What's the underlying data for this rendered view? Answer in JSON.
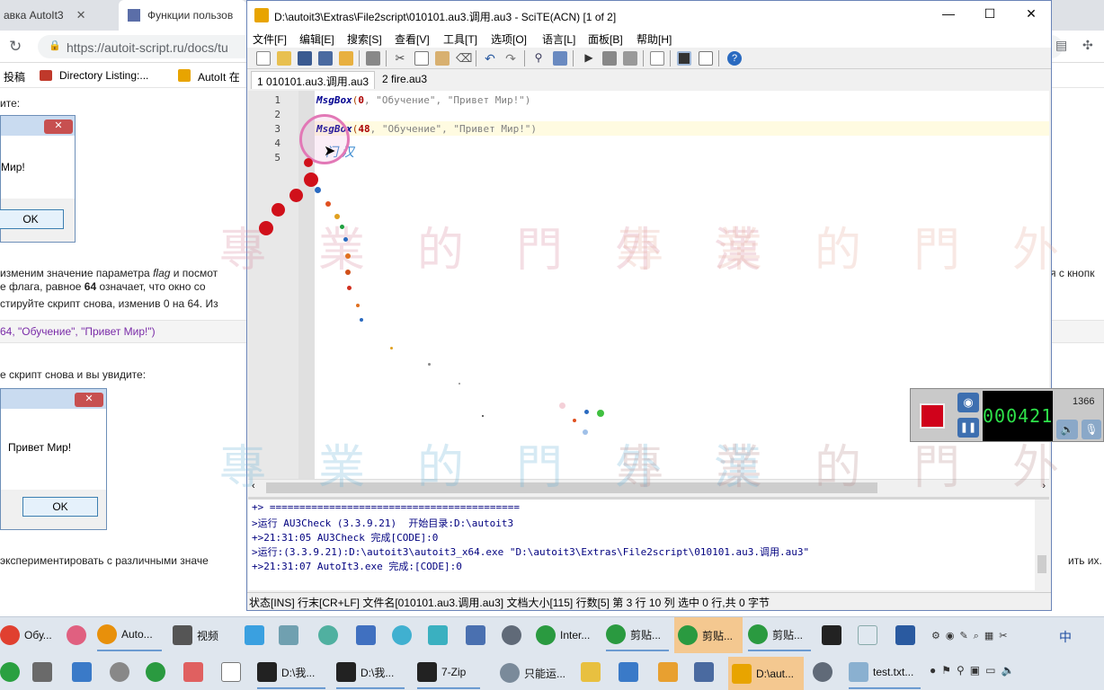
{
  "browser": {
    "tabs": [
      {
        "title": "авка AutoIt3"
      },
      {
        "title": "Функции пользов"
      }
    ],
    "url": "https://autoit-script.ru/docs/tu",
    "bookmarks": [
      "投稿",
      "Directory Listing:...",
      "AutoIt 在"
    ],
    "page": {
      "line1": "ите:",
      "msgbox1_text": "Мир!",
      "msgbox1_ok": "OK",
      "para1_a": "изменим значение параметра ",
      "para1_flag": "flag",
      "para1_b": " и посмот",
      "para1_right": "я с кнопк",
      "para2": "е флага, равное ",
      "para2_bold": "64",
      "para2_b": " означает, что окно со",
      "para3": "стируйте скрипт снова, изменив 0 на 64. Из",
      "code": "64, \"Обучение\", \"Привет Мир!\")",
      "line4": "е скрипт снова и вы увидите:",
      "msgbox2_text": "Привет Мир!",
      "msgbox2_ok": "OK",
      "line5": "экспериментировать с различными значе",
      "line5_right": "ить их."
    }
  },
  "scite": {
    "title": "D:\\autoit3\\Extras\\File2script\\010101.au3.调用.au3 - SciTE(ACN) [1 of 2]",
    "menu": [
      "文件[F]",
      "编辑[E]",
      "搜索[S]",
      "查看[V]",
      "工具[T]",
      "选项[O]",
      "语言[L]",
      "面板[B]",
      "帮助[H]"
    ],
    "tabs": [
      "1 010101.au3.调用.au3",
      "2 fire.au3"
    ],
    "line_numbers": [
      "1",
      "2",
      "3",
      "4",
      "5"
    ],
    "code": {
      "l1_fn": "MsgBox",
      "l1_open": "(",
      "l1_num": "0",
      "l1_rest": ", \"Обучение\", \"Привет Мир!\")",
      "l3_fn": "MsgBox",
      "l3_open": "(",
      "l3_num": "48",
      "l3_rest": ", \"Обучение\", \"Привет Мир!\")"
    },
    "ime_hint": "门 汉",
    "output": [
      "+> ==========================================",
      ">运行 AU3Check (3.3.9.21)  开始目录:D:\\autoit3",
      "+>21:31:05 AU3Check 完成[CODE]:0",
      ">运行:(3.3.9.21):D:\\autoit3\\autoit3_x64.exe \"D:\\autoit3\\Extras\\File2script\\010101.au3.调用.au3\"",
      "+>21:31:07 AutoIt3.exe 完成:[CODE]:0"
    ],
    "status": "状态[INS] 行末[CR+LF] 文件名[010101.au3.调用.au3] 文档大小[115] 行数[5] 第 3 行 10 列 选中 0 行,共 0 字节"
  },
  "watermark": "專業的門外漢",
  "recorder": {
    "time": "000421",
    "resolution": "1366",
    "stop_color": "#d0021b",
    "digits_color": "#2ee24a"
  },
  "taskbar": {
    "row1": [
      {
        "label": "Обу...",
        "icon": "chrome-icon"
      },
      {
        "label": "Auto...",
        "icon": "search-icon"
      },
      {
        "label": "视频",
        "icon": "film-icon"
      },
      {
        "label": "Inter...",
        "icon": "ie-icon"
      },
      {
        "label": "剪贴...",
        "icon": "ie-icon"
      },
      {
        "label": "剪贴...",
        "icon": "ie-icon"
      },
      {
        "label": "剪贴...",
        "icon": "ie-icon"
      }
    ],
    "row2": [
      {
        "label": "D:\\我...",
        "icon": "7z-icon"
      },
      {
        "label": "D:\\我...",
        "icon": "7z-icon"
      },
      {
        "label": "7-Zip",
        "icon": "7z-icon"
      },
      {
        "label": "只能运...",
        "icon": "app-icon"
      },
      {
        "label": "D:\\aut...",
        "icon": "autoit-icon"
      },
      {
        "label": "test.txt...",
        "icon": "notepad-icon"
      }
    ],
    "ime": "中"
  },
  "colors": {
    "accent_orange": "#f4c890",
    "scite_border": "#6a84b8",
    "keyword": "#000090",
    "number": "#ab0000"
  }
}
